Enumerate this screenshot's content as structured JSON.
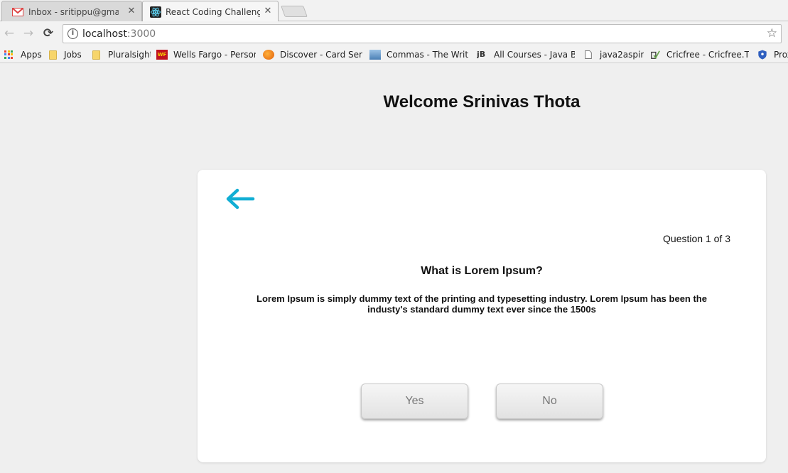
{
  "browser": {
    "tabs": [
      {
        "title": "Inbox - sritippu@gmail.c",
        "icon": "gmail-icon",
        "active": false
      },
      {
        "title": "React Coding Challenge",
        "icon": "react-icon",
        "active": true
      }
    ],
    "close_glyph": "✕",
    "url_host": "localhost",
    "url_port": ":3000",
    "nav": {
      "back": "←",
      "forward": "→",
      "reload": "⟳",
      "star": "☆",
      "info": "i"
    },
    "bookmarks": [
      {
        "label": "Apps",
        "icon": "apps-grid-icon"
      },
      {
        "label": "Jobs",
        "icon": "folder-icon"
      },
      {
        "label": "Pluralsight",
        "icon": "folder-icon"
      },
      {
        "label": "Wells Fargo - Persona",
        "icon": "wells-fargo-icon",
        "badge": "WF"
      },
      {
        "label": "Discover - Card Servic",
        "icon": "discover-icon"
      },
      {
        "label": "Commas - The Writin",
        "icon": "commas-icon"
      },
      {
        "label": "All Courses - Java Bra",
        "icon": "jb-icon",
        "badge": "jB"
      },
      {
        "label": "java2aspire",
        "icon": "page-icon"
      },
      {
        "label": "Cricfree - Cricfree.Tv -",
        "icon": "cricfree-icon"
      },
      {
        "label": "Prox",
        "icon": "shield-icon"
      }
    ]
  },
  "page": {
    "welcome": "Welcome Srinivas Thota",
    "question_counter": "Question 1 of 3",
    "question_title": "What is Lorem Ipsum?",
    "question_text": "Lorem Ipsum is simply dummy text of the printing and typesetting industry. Lorem Ipsum has been the industy's standard dummy text ever since the 1500s",
    "yes_label": "Yes",
    "no_label": "No"
  },
  "colors": {
    "accent": "#11aed4",
    "background": "#efefef",
    "card": "#ffffff"
  }
}
